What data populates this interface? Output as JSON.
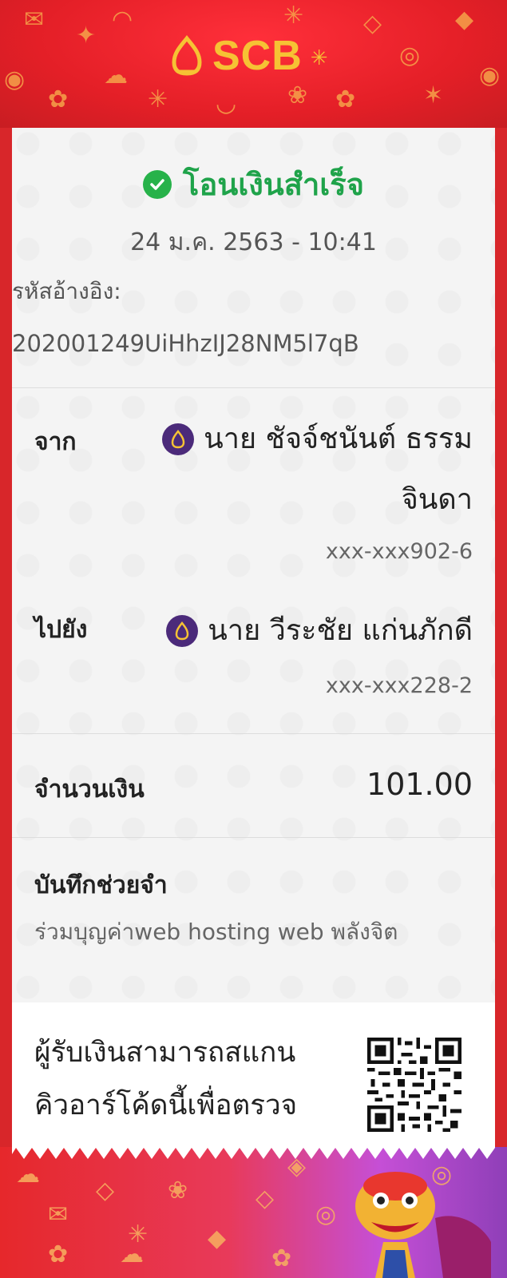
{
  "header": {
    "logo_text": "SCB",
    "colors": {
      "background": "#e41f27",
      "logo": "#f6c234"
    }
  },
  "transfer": {
    "status": "โอนเงินสำเร็จ",
    "datetime": "24 ม.ค. 2563 - 10:41",
    "reference_label": "รหัสอ้างอิง:",
    "reference_value": "202001249UiHhzIJ28NM5l7qB"
  },
  "from": {
    "label": "จาก",
    "name_line1": "นาย ชัจจ์ชนันต์ ธรรม",
    "name_line2": "จินดา",
    "account": "xxx-xxx902-6"
  },
  "to": {
    "label": "ไปยัง",
    "name": "นาย วีระชัย แก่นภักดี",
    "account": "xxx-xxx228-2"
  },
  "amount": {
    "label": "จำนวนเงิน",
    "value": "101.00"
  },
  "memo": {
    "label": "บันทึกช่วยจำ",
    "value": "ร่วมบุญค่าweb hosting web พลังจิต"
  },
  "qr": {
    "line1": "ผู้รับเงินสามารถสแกน",
    "line2": "คิวอาร์โค้ดนี้เพื่อตรวจ"
  },
  "icons": [
    "scb-logo-icon",
    "check-circle-icon",
    "scb-bank-icon",
    "qr-code-icon",
    "lion-dance-mascot-icon"
  ],
  "colors": {
    "success": "#1fa34a",
    "bank_icon": "#4b2a7a",
    "card": "#f4f4f4"
  }
}
